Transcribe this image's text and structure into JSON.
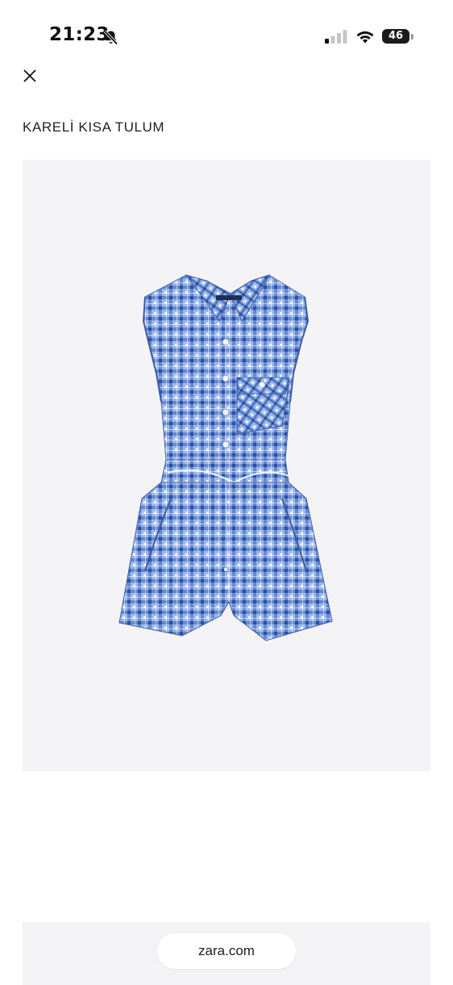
{
  "status_bar": {
    "time": "21:23",
    "battery_level": "46",
    "icons": [
      "bell-slash-icon",
      "signal-icon",
      "wifi-icon",
      "battery-icon"
    ]
  },
  "header": {
    "close_icon": "close-icon"
  },
  "product": {
    "title": "KARELİ KISA TULUM",
    "image": "checkered-romper-image",
    "image_colors": {
      "background": "#f3f3f6",
      "fabric_base": "#8fb0e6",
      "check_dark": "#3560b8",
      "check_light": "#ffffff"
    }
  },
  "browser": {
    "url": "zara.com"
  }
}
